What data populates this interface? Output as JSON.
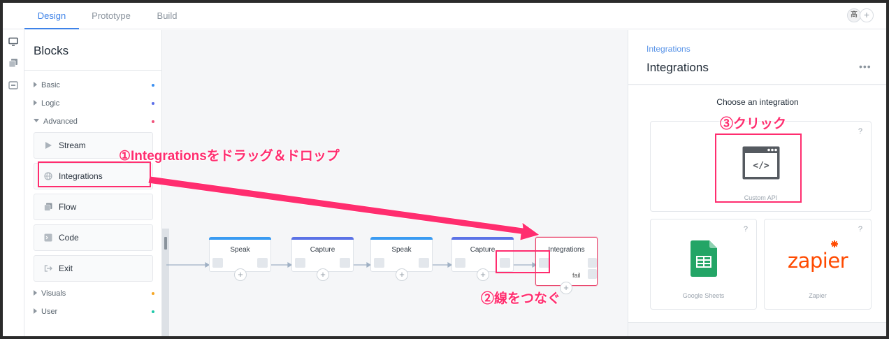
{
  "tabs": [
    {
      "label": "Design"
    },
    {
      "label": "Prototype"
    },
    {
      "label": "Build"
    }
  ],
  "user": {
    "avatar_text": "高",
    "add_label": "+"
  },
  "blocks_panel": {
    "title": "Blocks",
    "categories": [
      {
        "label": "Basic",
        "color": "#3a8ff0"
      },
      {
        "label": "Logic",
        "color": "#5b6ee8"
      },
      {
        "label": "Advanced",
        "color": "#f0527a"
      },
      {
        "label": "Visuals",
        "color": "#f5a623"
      },
      {
        "label": "User",
        "color": "#1fc8a8"
      }
    ],
    "advanced_items": [
      {
        "label": "Stream",
        "icon": "play-icon"
      },
      {
        "label": "Integrations",
        "icon": "globe-icon"
      },
      {
        "label": "Flow",
        "icon": "flow-icon"
      },
      {
        "label": "Code",
        "icon": "code-icon"
      },
      {
        "label": "Exit",
        "icon": "exit-icon"
      }
    ]
  },
  "canvas": {
    "nodes": [
      {
        "label": "Speak",
        "color": "#3a9bf2"
      },
      {
        "label": "Capture",
        "color": "#5b72e6"
      },
      {
        "label": "Speak",
        "color": "#3a9bf2"
      },
      {
        "label": "Capture",
        "color": "#5b72e6"
      }
    ],
    "integration_node": {
      "label": "Integrations",
      "fail_label": "fail"
    },
    "add_label": "+"
  },
  "right_panel": {
    "breadcrumb": "Integrations",
    "title": "Integrations",
    "more_label": "•••",
    "choose_title": "Choose an integration",
    "help_label": "?",
    "integrations": [
      {
        "label": "Custom API",
        "code_label": "</>"
      },
      {
        "label": "Google Sheets"
      },
      {
        "label": "Zapier",
        "logo_text": "zapier"
      }
    ]
  },
  "annotations": {
    "step1": "①Integrationsをドラッグ＆ドロップ",
    "step2": "②線をつなぐ",
    "step3": "③クリック"
  }
}
